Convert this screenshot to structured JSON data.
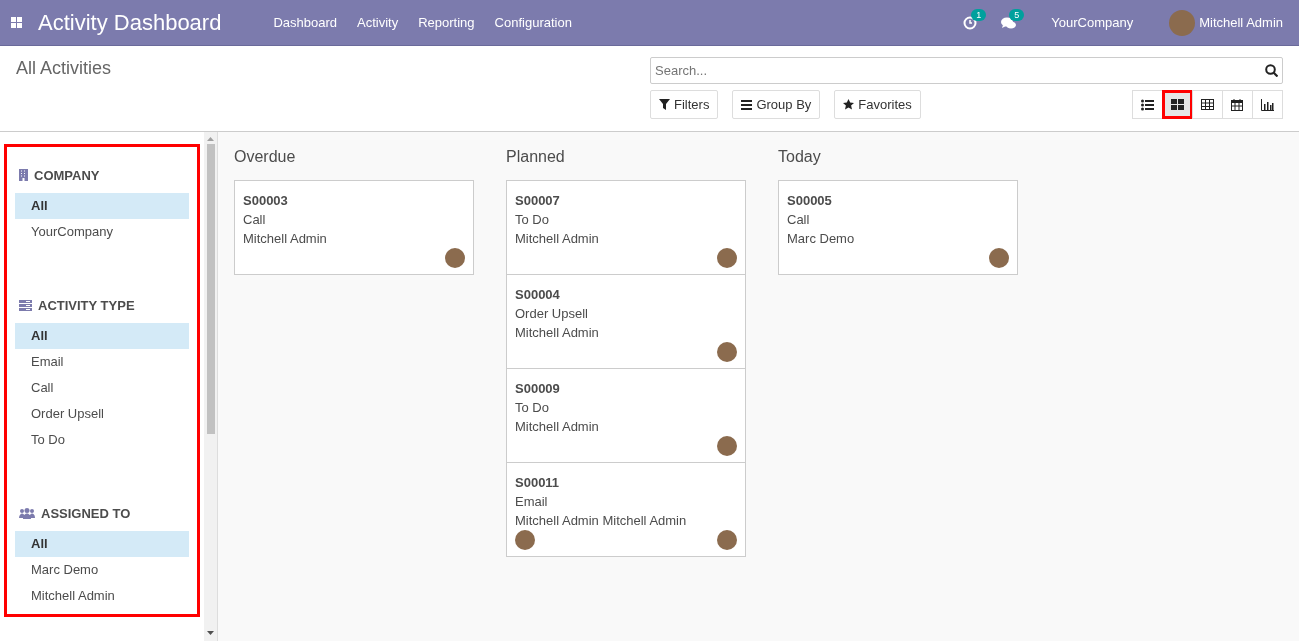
{
  "navbar": {
    "app_title": "Activity Dashboard",
    "menu": [
      "Dashboard",
      "Activity",
      "Reporting",
      "Configuration"
    ],
    "activity_count": "1",
    "message_count": "5",
    "company": "YourCompany",
    "user": "Mitchell Admin"
  },
  "control_panel": {
    "breadcrumb": "All Activities",
    "search": {
      "placeholder": "Search..."
    },
    "filter_buttons": [
      {
        "kind": "filter",
        "label": "Filters"
      },
      {
        "kind": "group",
        "label": "Group By"
      },
      {
        "kind": "favorite",
        "label": "Favorites"
      }
    ],
    "views": [
      {
        "kind": "list",
        "selected": false,
        "highlighted": false
      },
      {
        "kind": "kanban",
        "selected": true,
        "highlighted": true
      },
      {
        "kind": "pivot",
        "selected": false,
        "highlighted": false
      },
      {
        "kind": "calendar",
        "selected": false,
        "highlighted": false
      },
      {
        "kind": "graph",
        "selected": false,
        "highlighted": false
      }
    ]
  },
  "sidebar": {
    "highlighted": true,
    "sections": [
      {
        "kind": "company",
        "title": "COMPANY",
        "items": [
          {
            "label": "All",
            "selected": true
          },
          {
            "label": "YourCompany",
            "selected": false
          }
        ]
      },
      {
        "kind": "activity_type",
        "title": "ACTIVITY TYPE",
        "items": [
          {
            "label": "All",
            "selected": true
          },
          {
            "label": "Email",
            "selected": false
          },
          {
            "label": "Call",
            "selected": false
          },
          {
            "label": "Order Upsell",
            "selected": false
          },
          {
            "label": "To Do",
            "selected": false
          }
        ]
      },
      {
        "kind": "assigned",
        "title": "ASSIGNED TO",
        "items": [
          {
            "label": "All",
            "selected": true
          },
          {
            "label": "Marc Demo",
            "selected": false
          },
          {
            "label": "Mitchell Admin",
            "selected": false
          }
        ]
      }
    ]
  },
  "columns": [
    {
      "title": "Overdue",
      "cards": [
        {
          "reference": "S00003",
          "activity_type": "Call",
          "assignee": "Mitchell Admin",
          "extra_avatar": false
        }
      ]
    },
    {
      "title": "Planned",
      "cards": [
        {
          "reference": "S00007",
          "activity_type": "To Do",
          "assignee": "Mitchell Admin",
          "extra_avatar": false
        },
        {
          "reference": "S00004",
          "activity_type": "Order Upsell",
          "assignee": "Mitchell Admin",
          "extra_avatar": false
        },
        {
          "reference": "S00009",
          "activity_type": "To Do",
          "assignee": "Mitchell Admin",
          "extra_avatar": false
        },
        {
          "reference": "S00011",
          "activity_type": "Email",
          "assignee": "Mitchell Admin Mitchell Admin",
          "extra_avatar": true
        }
      ]
    },
    {
      "title": "Today",
      "cards": [
        {
          "reference": "S00005",
          "activity_type": "Call",
          "assignee": "Marc Demo",
          "extra_avatar": false
        }
      ]
    }
  ]
}
